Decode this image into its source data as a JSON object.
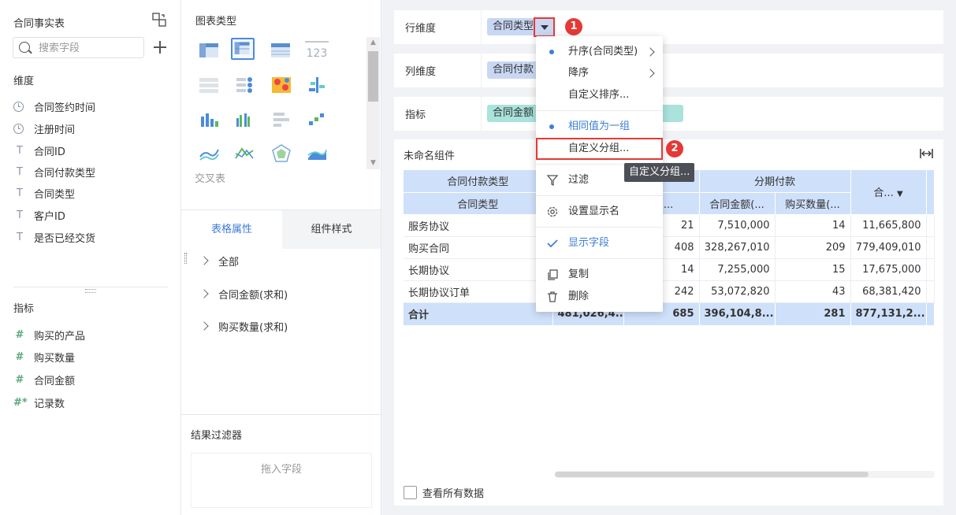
{
  "left": {
    "title": "合同事实表",
    "search_placeholder": "搜索字段",
    "dimensions_title": "维度",
    "dimensions": [
      {
        "label": "合同签约时间",
        "type": "date"
      },
      {
        "label": "注册时间",
        "type": "date"
      },
      {
        "label": "合同ID",
        "type": "text"
      },
      {
        "label": "合同付款类型",
        "type": "text"
      },
      {
        "label": "合同类型",
        "type": "text"
      },
      {
        "label": "客户ID",
        "type": "text"
      },
      {
        "label": "是否已经交货",
        "type": "text"
      }
    ],
    "measures_title": "指标",
    "measures": [
      {
        "label": "购买的产品",
        "glyph": "#"
      },
      {
        "label": "购买数量",
        "glyph": "#"
      },
      {
        "label": "合同金额",
        "glyph": "#"
      },
      {
        "label": "记录数",
        "glyph": "#*"
      }
    ]
  },
  "middle": {
    "chart_type_title": "图表类型",
    "selected_chart_label": "交叉表",
    "tabs": {
      "table_props": "表格属性",
      "component_style": "组件样式"
    },
    "props": [
      "全部",
      "合同金额(求和)",
      "购买数量(求和)"
    ],
    "result_filter_title": "结果过滤器",
    "drop_hint": "拖入字段",
    "icon_123": "123"
  },
  "config": {
    "row_dim_label": "行维度",
    "row_dim_pill": "合同类型",
    "col_dim_label": "列维度",
    "col_dim_pill": "合同付款",
    "measure_label": "指标",
    "measure_pill": "合同金额",
    "measure_pill_tail": ")"
  },
  "widget": {
    "title": "未命名组件",
    "header_row1": {
      "col1": "合同付款类型",
      "group2": "分期付款",
      "total": "合..."
    },
    "header_row2": {
      "col1": "合同类型",
      "c3": "量(...",
      "c4": "合同金额(...",
      "c5": "购买数量(..."
    },
    "rows": [
      {
        "name": "服务协议",
        "v2": "",
        "v3": "21",
        "v4": "7,510,000",
        "v5": "14",
        "v6": "11,665,800"
      },
      {
        "name": "购买合同",
        "v2": "",
        "v3": "408",
        "v4": "328,267,010",
        "v5": "209",
        "v6": "779,409,010"
      },
      {
        "name": "长期协议",
        "v2": "",
        "v3": "14",
        "v4": "7,255,000",
        "v5": "15",
        "v6": "17,675,000"
      },
      {
        "name": "长期协议订单",
        "v2": "",
        "v3": "242",
        "v4": "53,072,820",
        "v5": "43",
        "v6": "68,381,420"
      }
    ],
    "total_row": {
      "name": "合计",
      "v2": "481,026,4...",
      "v3": "685",
      "v4": "396,104,8...",
      "v5": "281",
      "v6": "877,131,2..."
    },
    "view_all": "查看所有数据"
  },
  "menu": {
    "items": [
      {
        "label": "升序(合同类型)",
        "dot": true,
        "submenu": true
      },
      {
        "label": "降序",
        "dot": false,
        "submenu": true
      },
      {
        "label": "自定义排序..."
      },
      {
        "label": "相同值为一组",
        "dot": true
      },
      {
        "label": "自定义分组..."
      },
      {
        "label": "过滤"
      },
      {
        "label": "设置显示名"
      },
      {
        "label": "显示字段"
      },
      {
        "label": "复制"
      },
      {
        "label": "删除"
      }
    ],
    "tooltip": "自定义分组..."
  },
  "badges": [
    "1",
    "2"
  ],
  "colors": {
    "accent": "#3d7ed8",
    "header_bg": "#cfe0fa",
    "annotation_red": "#e53935",
    "teal_pill": "#a9e3dc"
  }
}
